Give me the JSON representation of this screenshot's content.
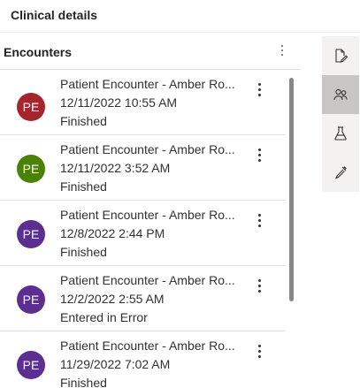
{
  "section_title": "Clinical details",
  "panel": {
    "title": "Encounters",
    "items": [
      {
        "initials": "PE",
        "avatar_color": "#a4262c",
        "title": "Patient Encounter - Amber Ro...",
        "datetime": "12/11/2022 10:55 AM",
        "status": "Finished"
      },
      {
        "initials": "PE",
        "avatar_color": "#498205",
        "title": "Patient Encounter - Amber Ro...",
        "datetime": "12/11/2022 3:52 AM",
        "status": "Finished"
      },
      {
        "initials": "PE",
        "avatar_color": "#5c2e91",
        "title": "Patient Encounter - Amber Ro...",
        "datetime": "12/8/2022 2:44 PM",
        "status": "Finished"
      },
      {
        "initials": "PE",
        "avatar_color": "#5c2e91",
        "title": "Patient Encounter - Amber Ro...",
        "datetime": "12/2/2022 2:55 AM",
        "status": "Entered in Error"
      },
      {
        "initials": "PE",
        "avatar_color": "#5c2e91",
        "title": "Patient Encounter - Amber Ro...",
        "datetime": "11/29/2022 7:02 AM",
        "status": "Finished"
      }
    ]
  },
  "rail": {
    "buttons": [
      {
        "icon": "document-edit-icon",
        "active": false
      },
      {
        "icon": "people-icon",
        "active": true
      },
      {
        "icon": "flask-icon",
        "active": false
      },
      {
        "icon": "dropper-icon",
        "active": false
      }
    ]
  }
}
